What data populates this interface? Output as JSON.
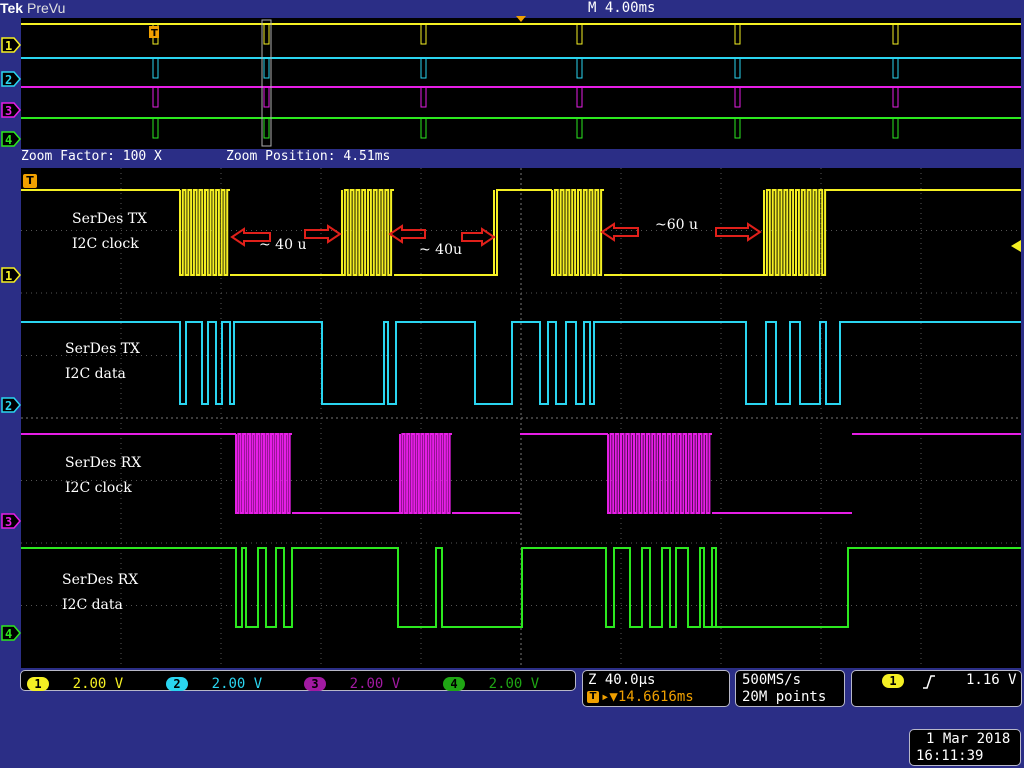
{
  "header": {
    "brand": "Tek",
    "mode": "PreVu",
    "timebase": "M 4.00ms"
  },
  "zoom": {
    "factor_text": "Zoom Factor: 100 X",
    "position_text": "Zoom Position: 4.51ms"
  },
  "channels": [
    {
      "id": "1",
      "color": "#f5f023",
      "scale": "2.00 V",
      "label_line1": "SerDes TX",
      "label_line2": "I2C clock"
    },
    {
      "id": "2",
      "color": "#2ad5f0",
      "scale": "2.00 V",
      "label_line1": "SerDes TX",
      "label_line2": "I2C data"
    },
    {
      "id": "3",
      "color": "#e61ee6",
      "scale": "2.00 V",
      "label_line1": "SerDes RX",
      "label_line2": "I2C clock"
    },
    {
      "id": "4",
      "color": "#2ce81f",
      "scale": "2.00 V",
      "label_line1": "SerDes RX",
      "label_line2": "I2C data"
    }
  ],
  "annotations": {
    "gap1": "~ 40 u",
    "gap2": "~ 40u",
    "gap3": "~60 u"
  },
  "trigger_marker": "T",
  "status": {
    "zoom_time": "Z 40.0µs",
    "trigger_position": "▸▼14.6616ms",
    "sample_rate": "500MS/s",
    "record_length": "20M points",
    "trigger_channel": "1",
    "trigger_level": "1.16 V",
    "date": "1 Mar 2018",
    "time": "16:11:39"
  }
}
